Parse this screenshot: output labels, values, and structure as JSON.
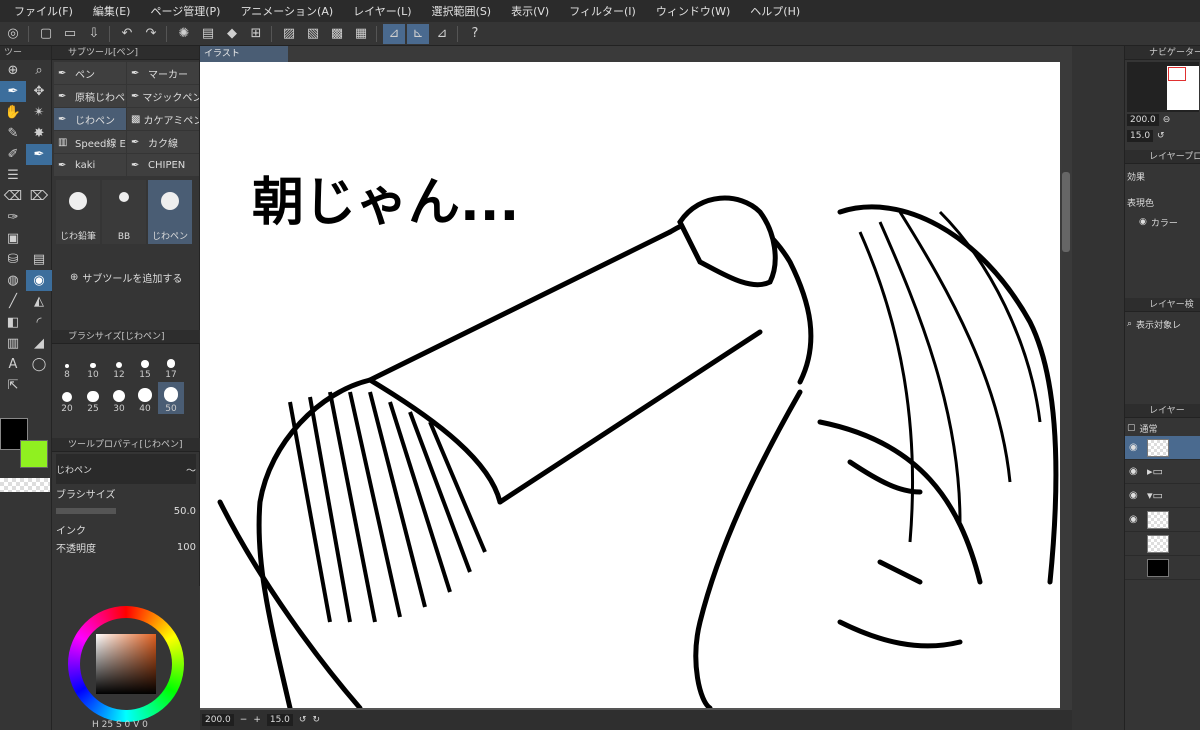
{
  "menu": [
    "ファイル(F)",
    "編集(E)",
    "ページ管理(P)",
    "アニメーション(A)",
    "レイヤー(L)",
    "選択範囲(S)",
    "表示(V)",
    "フィルター(I)",
    "ウィンドウ(W)",
    "ヘルプ(H)"
  ],
  "tools_header": "ツー",
  "subtool_panel": {
    "title": "サブツール[ペン]",
    "items": [
      {
        "label": "ペン",
        "icon": "pen-icon"
      },
      {
        "label": "マーカー",
        "icon": "marker-icon"
      },
      {
        "label": "原稿じわペ",
        "icon": "pen-icon"
      },
      {
        "label": "マジックペン",
        "icon": "pen-icon"
      },
      {
        "label": "じわペン",
        "icon": "pen-icon"
      },
      {
        "label": "カケアミペン",
        "icon": "pattern-icon"
      },
      {
        "label": "Speed線 E",
        "icon": "speedline-icon"
      },
      {
        "label": "カク線",
        "icon": "pen-icon"
      },
      {
        "label": "kaki",
        "icon": "pen-icon"
      },
      {
        "label": "CHIPEN",
        "icon": "pen-icon"
      }
    ],
    "presets": [
      "じわ鉛筆",
      "BB",
      "じわペン"
    ],
    "add_label": "サブツールを追加する"
  },
  "brush_size_panel": {
    "title": "ブラシサイズ[じわペン]",
    "sizes": [
      "8",
      "10",
      "12",
      "15",
      "17",
      "20",
      "25",
      "30",
      "40",
      "50"
    ]
  },
  "tool_property_panel": {
    "title": "ツールプロパティ[じわペン]",
    "tool_name": "じわペン",
    "brush_size_label": "ブラシサイズ",
    "brush_size_value": "50.0",
    "ink_label": "インク",
    "opacity_label": "不透明度",
    "opacity_value": "100"
  },
  "color_readout": {
    "h": "25",
    "s": "0",
    "v": "0"
  },
  "document_tab": "イラスト",
  "canvas_text": "朝じゃん...",
  "status": {
    "zoom": "200.0",
    "angle": "15.0"
  },
  "navigator": {
    "title": "ナビゲーター",
    "zoom": "200.0",
    "angle": "15.0"
  },
  "layer_property": {
    "title": "レイヤープロ",
    "effect_label": "効果",
    "color_label": "表現色",
    "color_value": "カラー"
  },
  "layer_search": {
    "title": "レイヤー検",
    "filter_label": "表示対象レ"
  },
  "layers": {
    "title": "レイヤー",
    "blend_mode": "通常"
  },
  "colors": {
    "fg": "#000000",
    "bg": "#90f020",
    "accent": "#4a6a8f"
  }
}
